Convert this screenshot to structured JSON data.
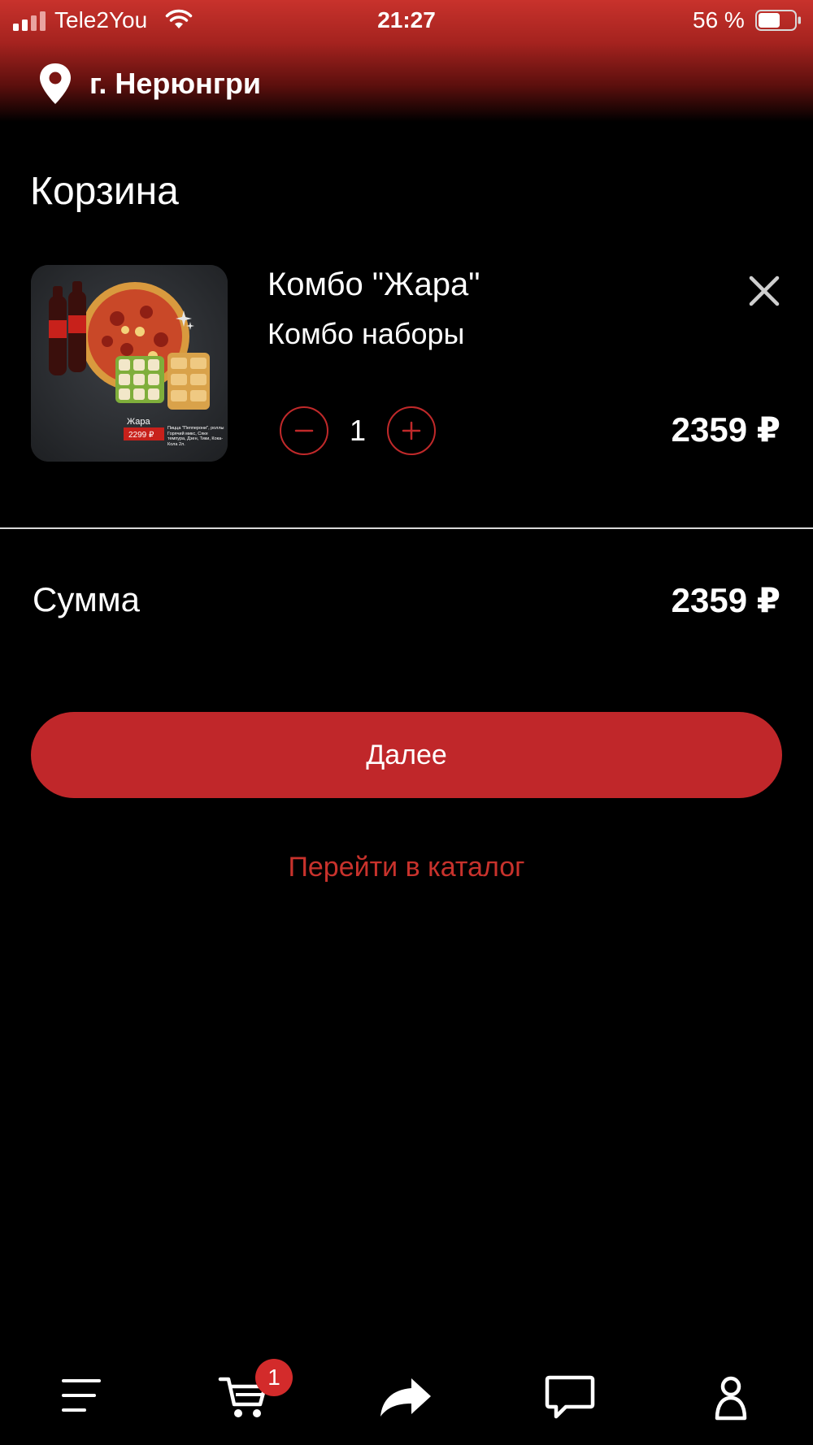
{
  "status_bar": {
    "carrier": "Tele2You",
    "time": "21:27",
    "battery": "56 %"
  },
  "header": {
    "city": "г. Нерюнгри"
  },
  "page": {
    "title": "Корзина"
  },
  "cart": {
    "items": [
      {
        "name": "Комбо \"Жара\"",
        "category": "Комбо наборы",
        "quantity": "1",
        "price": "2359 ₽",
        "image_label": "Жара",
        "image_price": "2299 ₽",
        "image_desc": "Пицца \"Пепперони\", роллы Горячий микс, Сяке темпура, Дзен, Тики, Кока-Кола 2л."
      }
    ]
  },
  "summary": {
    "label": "Сумма",
    "value": "2359 ₽"
  },
  "actions": {
    "next": "Далее",
    "catalog": "Перейти в каталог"
  },
  "tabbar": {
    "cart_badge": "1",
    "icons": [
      "menu-icon",
      "cart-icon",
      "share-icon",
      "chat-icon",
      "profile-icon"
    ]
  },
  "colors": {
    "accent": "#c0272a",
    "background": "#000000",
    "text": "#ffffff"
  }
}
